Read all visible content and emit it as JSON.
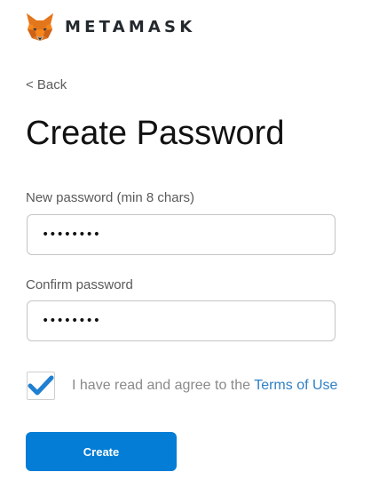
{
  "header": {
    "logo_icon": "metamask-fox-icon",
    "wordmark": "METAMASK"
  },
  "nav": {
    "back_label": "< Back"
  },
  "page": {
    "title": "Create Password"
  },
  "form": {
    "new_password": {
      "label": "New password (min 8 chars)",
      "value": "••••••••"
    },
    "confirm_password": {
      "label": "Confirm password",
      "value": "••••••••"
    },
    "terms": {
      "checked": true,
      "check_icon": "checkmark-icon",
      "text": "I have read and agree to the",
      "link_text": "Terms of Use"
    },
    "create_label": "Create"
  },
  "colors": {
    "accent": "#037dd6",
    "link": "#2f80c5",
    "check": "#1f7fd0"
  }
}
